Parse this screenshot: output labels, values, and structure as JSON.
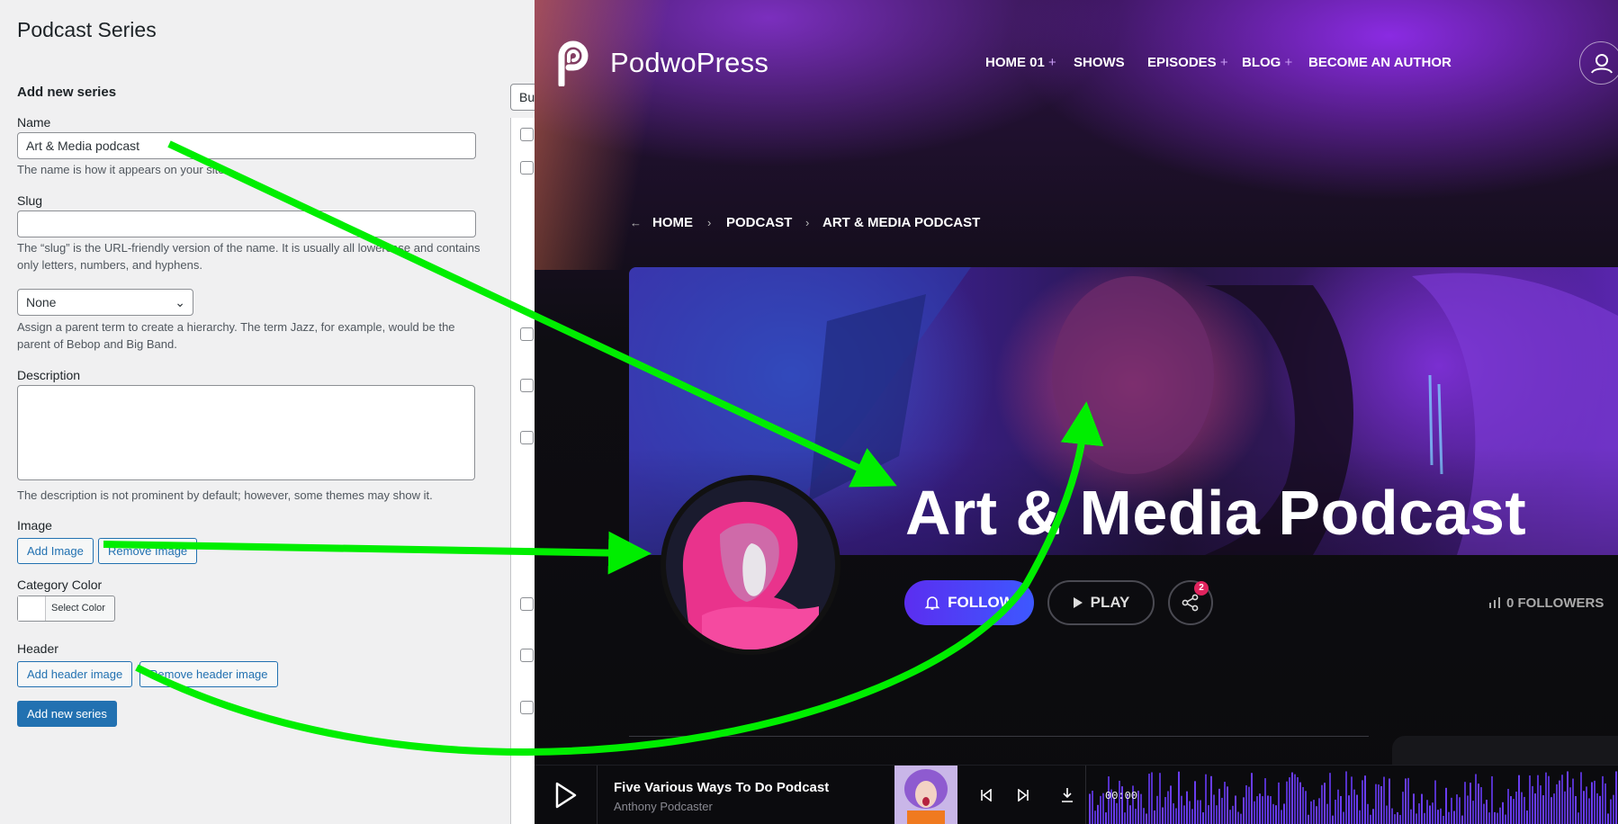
{
  "wp": {
    "page_title": "Podcast Series",
    "form_title": "Add new series",
    "name_label": "Name",
    "name_value": "Art & Media podcast",
    "name_help": "The name is how it appears on your site.",
    "slug_label": "Slug",
    "slug_value": "",
    "slug_help": "The “slug” is the URL-friendly version of the name. It is usually all lowercase and contains only letters, numbers, and hyphens.",
    "parent_value": "None",
    "parent_help": "Assign a parent term to create a hierarchy. The term Jazz, for example, would be the parent of Bebop and Big Band.",
    "description_label": "Description",
    "description_help": "The description is not prominent by default; however, some themes may show it.",
    "image_label": "Image",
    "add_image": "Add Image",
    "remove_image": "Remove Image",
    "category_color_label": "Category Color",
    "select_color": "Select Color",
    "header_label": "Header",
    "add_header_image": "Add header image",
    "remove_header_image": "Remove header image",
    "submit": "Add new series",
    "bulk_label": "Bu"
  },
  "site": {
    "logo_text": "PodwoPress",
    "nav": [
      {
        "label": "HOME 01",
        "plus": "+"
      },
      {
        "label": "SHOWS",
        "plus": ""
      },
      {
        "label": "EPISODES",
        "plus": "+"
      },
      {
        "label": "BLOG",
        "plus": "+"
      },
      {
        "label": "BECOME AN AUTHOR",
        "plus": ""
      }
    ],
    "breadcrumb": [
      "HOME",
      "PODCAST",
      "ART & MEDIA PODCAST"
    ],
    "hero_title": "Art & Media Podcast",
    "follow": "FOLLOW",
    "play": "PLAY",
    "share_count": "2",
    "followers": "0 FOLLOWERS",
    "player": {
      "title": "Five Various Ways To Do Podcast",
      "artist": "Anthony Podcaster",
      "time": "00:00"
    },
    "colors": {
      "accent": "#5b2ef0",
      "wp_blue": "#2271b1",
      "arrow": "#00ee00"
    }
  }
}
